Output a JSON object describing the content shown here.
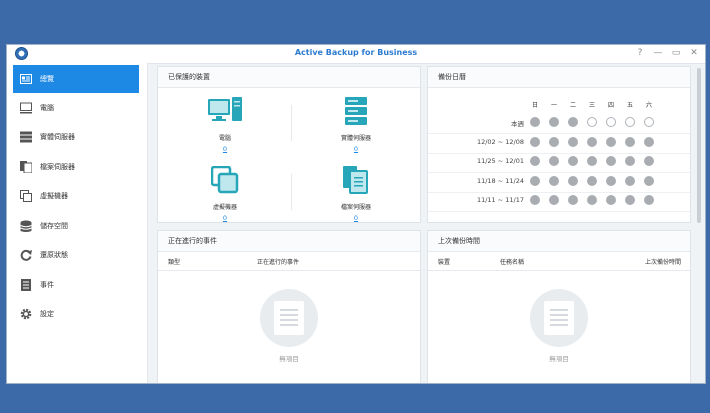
{
  "window": {
    "title": "Active Backup for Business",
    "controls": [
      "?",
      "—",
      "▭",
      "✕"
    ]
  },
  "sidebar": {
    "items": [
      {
        "label": "總覽",
        "icon": "overview-icon",
        "active": true
      },
      {
        "label": "電腦",
        "icon": "pc-icon"
      },
      {
        "label": "實體伺服器",
        "icon": "physical-server-icon"
      },
      {
        "label": "檔案伺服器",
        "icon": "file-server-icon"
      },
      {
        "label": "虛擬機器",
        "icon": "virtual-machine-icon"
      },
      {
        "label": "儲存空間",
        "icon": "storage-icon"
      },
      {
        "label": "還原狀態",
        "icon": "restore-icon"
      },
      {
        "label": "事件",
        "icon": "log-icon"
      },
      {
        "label": "設定",
        "icon": "gear-icon"
      }
    ]
  },
  "protected": {
    "title": "已保護的裝置",
    "devices": [
      {
        "label": "電腦",
        "count": "0",
        "icon": "pc-icon"
      },
      {
        "label": "實體伺服器",
        "count": "0",
        "icon": "server-icon"
      },
      {
        "label": "虛擬機器",
        "count": "0",
        "icon": "vm-icon"
      },
      {
        "label": "檔案伺服器",
        "count": "0",
        "icon": "file-server-icon"
      }
    ]
  },
  "calendar": {
    "title": "備份日曆",
    "days": [
      "日",
      "一",
      "二",
      "三",
      "四",
      "五",
      "六"
    ],
    "rows": [
      {
        "label": "本週",
        "dots": [
          1,
          1,
          1,
          0,
          0,
          0,
          0
        ]
      },
      {
        "label": "12/02 ~ 12/08",
        "dots": [
          1,
          1,
          1,
          1,
          1,
          1,
          1
        ]
      },
      {
        "label": "11/25 ~ 12/01",
        "dots": [
          1,
          1,
          1,
          1,
          1,
          1,
          1
        ]
      },
      {
        "label": "11/18 ~ 11/24",
        "dots": [
          1,
          1,
          1,
          1,
          1,
          1,
          1
        ]
      },
      {
        "label": "11/11 ~ 11/17",
        "dots": [
          1,
          1,
          1,
          1,
          1,
          1,
          1
        ]
      }
    ]
  },
  "running": {
    "title": "正在進行的事件",
    "col_type": "類型",
    "col_event": "正在進行的事件",
    "empty": "無項目"
  },
  "last_backup": {
    "title": "上次備份時間",
    "col_device": "裝置",
    "col_task": "任務名稱",
    "col_time": "上次備份時間",
    "empty": "無項目"
  },
  "colors": {
    "accent": "#1e88e5",
    "teal": "#26a6b8",
    "dot_filled": "#a9adb1"
  }
}
